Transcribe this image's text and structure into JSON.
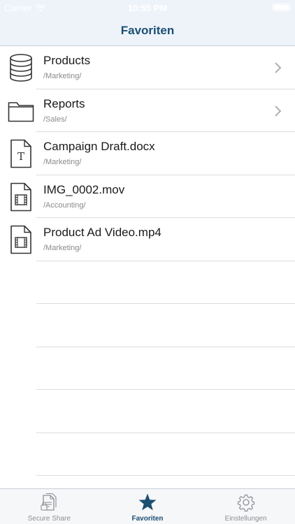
{
  "status_bar": {
    "carrier": "Carrier",
    "time": "10:55 PM"
  },
  "nav": {
    "title": "Favoriten"
  },
  "items": [
    {
      "title": "Products",
      "path": "/Marketing/",
      "icon": "database-icon",
      "has_chevron": true
    },
    {
      "title": "Reports",
      "path": "/Sales/",
      "icon": "folder-icon",
      "has_chevron": true
    },
    {
      "title": "Campaign Draft.docx",
      "path": "/Marketing/",
      "icon": "text-document-icon",
      "has_chevron": false
    },
    {
      "title": "IMG_0002.mov",
      "path": "/Accounting/",
      "icon": "video-file-icon",
      "has_chevron": false
    },
    {
      "title": "Product Ad Video.mp4",
      "path": "/Marketing/",
      "icon": "video-file-icon",
      "has_chevron": false
    }
  ],
  "tabs": [
    {
      "label": "Secure Share",
      "icon": "secure-share-icon",
      "active": false
    },
    {
      "label": "Favoriten",
      "icon": "star-icon",
      "active": true
    },
    {
      "label": "Einstellungen",
      "icon": "gear-icon",
      "active": false
    }
  ],
  "colors": {
    "accent": "#1b4f72",
    "bar_background": "#eef3fa",
    "inactive": "#8e8e93"
  }
}
